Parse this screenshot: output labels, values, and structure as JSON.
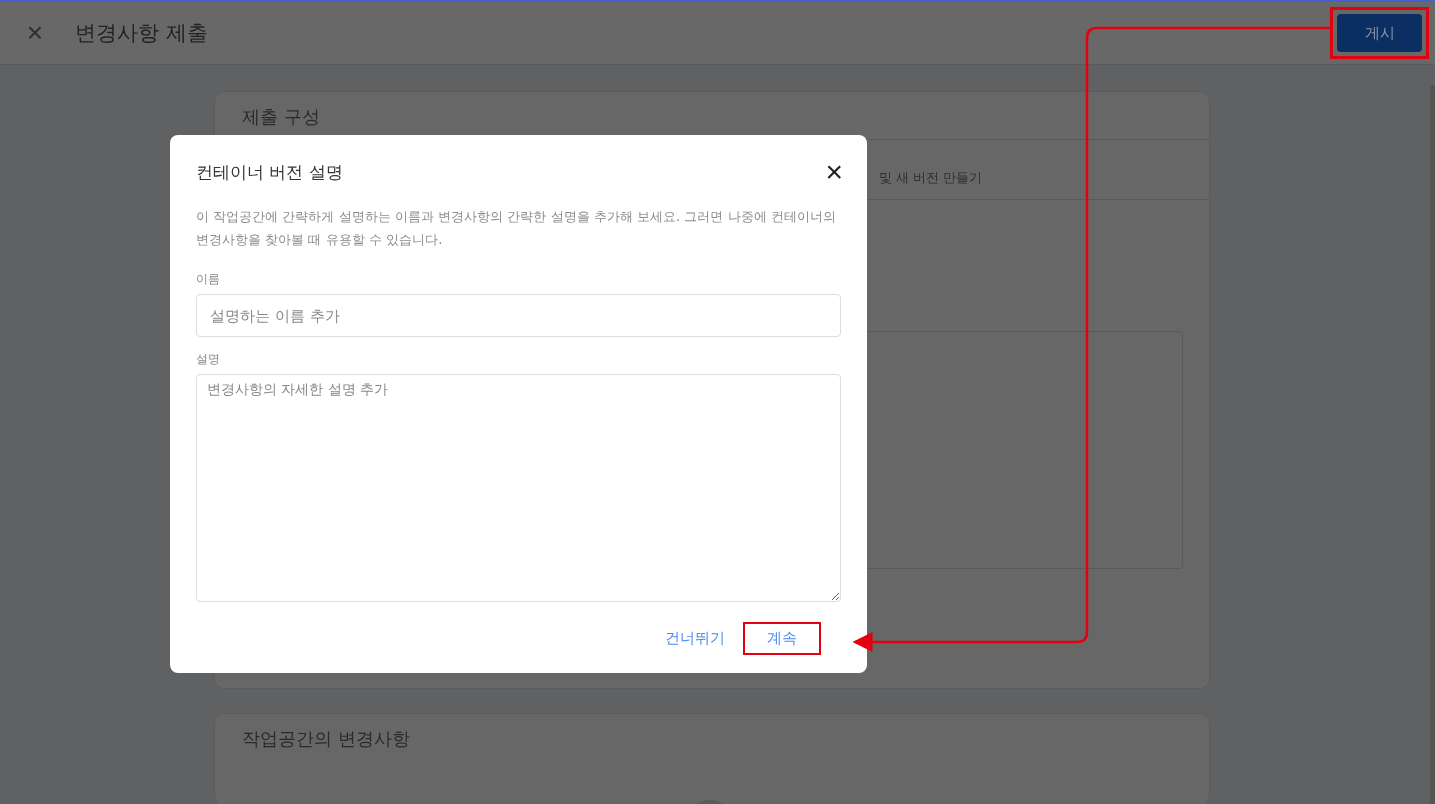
{
  "header": {
    "close": "×",
    "title": "변경사항 제출",
    "publish_button": "게시"
  },
  "cards": [
    {
      "title": "제출 구성",
      "row_text": "및 새 버전 만들기"
    },
    {
      "title": "작업공간의 변경사항"
    }
  ],
  "dialog": {
    "title": "컨테이너 버전 설명",
    "close": "×",
    "description": "이 작업공간에 간략하게 설명하는 이름과 변경사항의 간략한 설명을 추가해 보세요. 그러면 나중에 컨테이너의 변경사항을 찾아볼 때 유용할 수 있습니다.",
    "fields": [
      {
        "kind": "input",
        "label": "이름",
        "placeholder": "설명하는 이름 추가"
      },
      {
        "kind": "textarea",
        "label": "설명",
        "placeholder": "변경사항의 자세한 설명 추가"
      }
    ],
    "buttons": [
      {
        "label": "건너뛰기",
        "highlighted": false
      },
      {
        "label": "계속",
        "highlighted": true
      }
    ]
  },
  "annotation": {
    "publish_highlighted": true
  }
}
